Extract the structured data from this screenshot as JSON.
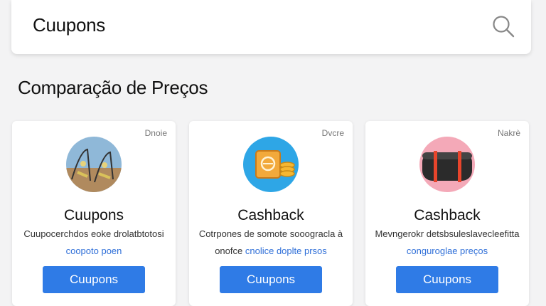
{
  "header": {
    "title": "Cuupons"
  },
  "section": {
    "title": "Comparação de Preços"
  },
  "cards": [
    {
      "tag": "Dnoie",
      "name": "Cuupons",
      "desc": "Cuupocerchdos eoke drolatbtotosi",
      "link_pre": "",
      "link": "coopoto poen",
      "button": "Cuupons",
      "icon": "playground-swing-icon"
    },
    {
      "tag": "Dvcre",
      "name": "Cashback",
      "desc": "Cotrpones de somote sooogracla à",
      "link_pre": "onofce",
      "link": "cnolice doplte prsos",
      "button": "Cuupons",
      "icon": "cash-coins-icon"
    },
    {
      "tag": "Nakrè",
      "name": "Cashback",
      "desc": "Mevngerokr detsbsuleslavecleefitta",
      "link_pre": "",
      "link": "conguroglae preços",
      "button": "Cuupons",
      "icon": "barrel-icon"
    }
  ],
  "colors": {
    "accent": "#2f7be6",
    "link": "#2f6fd8"
  }
}
